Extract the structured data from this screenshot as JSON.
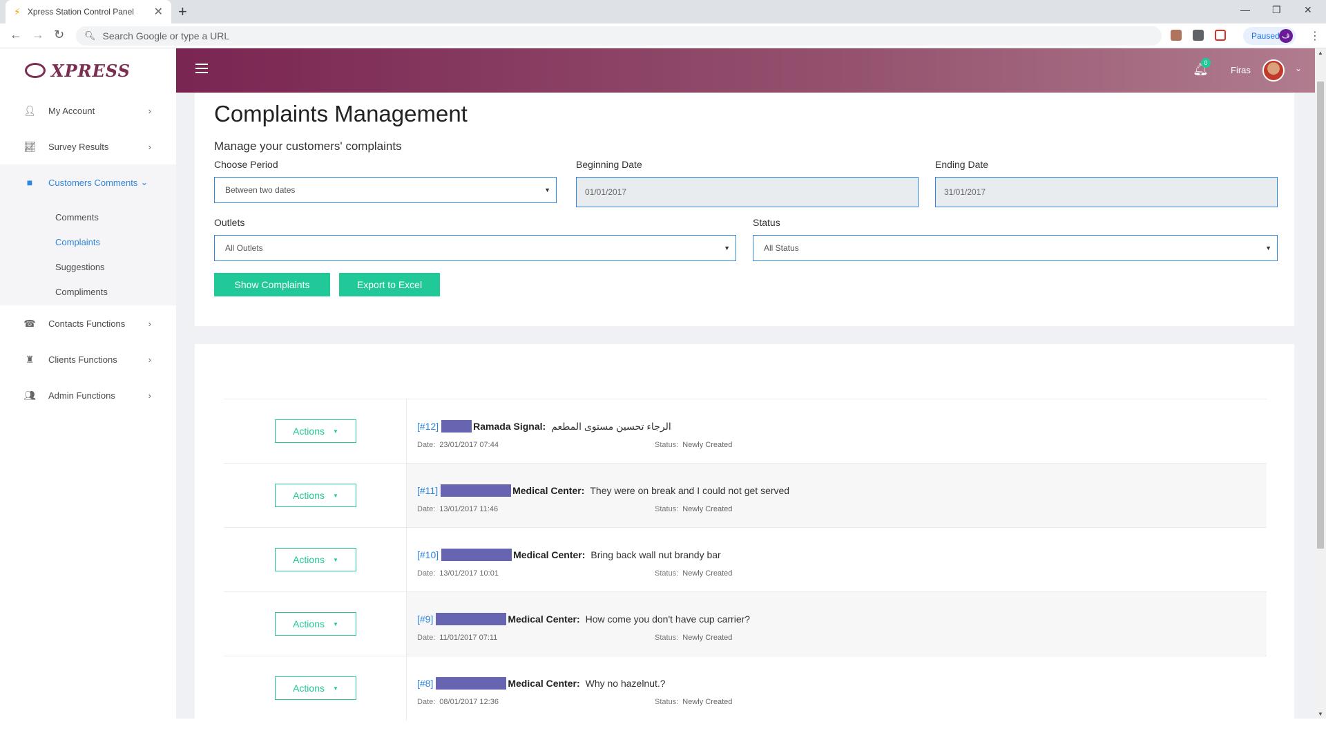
{
  "browser": {
    "tab_title": "Xpress Station Control Panel",
    "tab_close": "✕",
    "new_tab": "+",
    "omnibox_placeholder": "Search Google or type a URL",
    "profile_label": "Paused",
    "profile_initial": "ف"
  },
  "brand": {
    "logo_text": "XPRESS",
    "color": "#7b2d52"
  },
  "sidebar": {
    "items": [
      {
        "label": "My Account",
        "icon": "user-icon"
      },
      {
        "label": "Survey Results",
        "icon": "chart-icon"
      },
      {
        "label": "Customers Comments",
        "icon": "comment-icon",
        "active": true
      },
      {
        "label": "Contacts Functions",
        "icon": "phone-icon"
      },
      {
        "label": "Clients Functions",
        "icon": "chess-icon"
      },
      {
        "label": "Admin Functions",
        "icon": "users-cog-icon"
      }
    ],
    "submenu": [
      {
        "label": "Comments"
      },
      {
        "label": "Complaints",
        "active": true
      },
      {
        "label": "Suggestions"
      },
      {
        "label": "Compliments"
      }
    ]
  },
  "topbar": {
    "notification_count": "0",
    "username": "Firas"
  },
  "filters": {
    "title": "Complaints Management",
    "subtitle": "Manage your customers' complaints",
    "period_label": "Choose Period",
    "period_value": "Between two dates",
    "begin_label": "Beginning Date",
    "begin_value": "01/01/2017",
    "end_label": "Ending Date",
    "end_value": "31/01/2017",
    "outlets_label": "Outlets",
    "outlets_value": "All Outlets",
    "status_label": "Status",
    "status_value": "All Status",
    "show_button": "Show Complaints",
    "export_button": "Export to Excel"
  },
  "complaints": [
    {
      "id": "[#12]",
      "outlet": "Ramada Signal:",
      "message": "الرجاء تحسين مستوى المطعم",
      "date": "23/01/2017 07:44",
      "status": "Newly Created",
      "action": "Actions"
    },
    {
      "id": "[#11]",
      "outlet": "Medical Center:",
      "message": "They were on break and I could not get served",
      "date": "13/01/2017 11:46",
      "status": "Newly Created",
      "action": "Actions"
    },
    {
      "id": "[#10]",
      "outlet": "Medical Center:",
      "message": "Bring back wall nut brandy bar",
      "date": "13/01/2017 10:01",
      "status": "Newly Created",
      "action": "Actions"
    },
    {
      "id": "[#9]",
      "outlet": "Medical Center:",
      "message": "How come you don't have cup carrier?",
      "date": "11/01/2017 07:11",
      "status": "Newly Created",
      "action": "Actions"
    },
    {
      "id": "[#8]",
      "outlet": "Medical Center:",
      "message": "Why no hazelnut.?",
      "date": "08/01/2017 12:36",
      "status": "Newly Created",
      "action": "Actions"
    }
  ],
  "labels": {
    "date": "Date:",
    "status": "Status:"
  },
  "colors": {
    "accent_green": "#20c997",
    "link_blue": "#2e86de",
    "redaction": "#6765b2",
    "header_start": "#7a2552"
  }
}
